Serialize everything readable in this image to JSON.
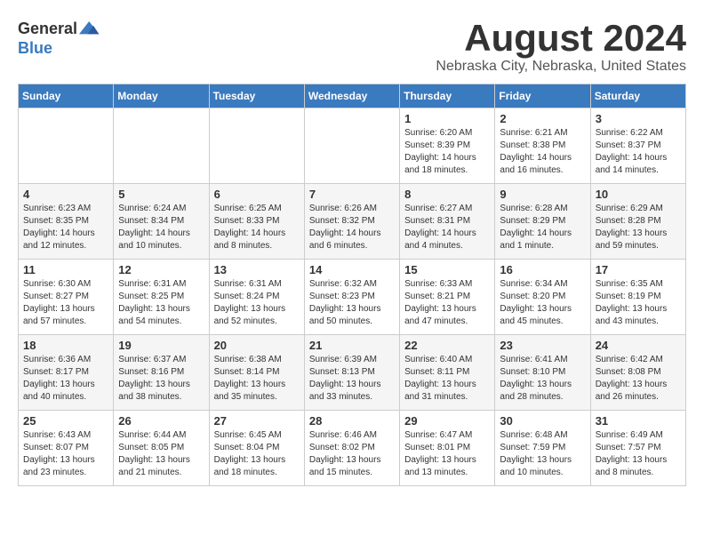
{
  "logo": {
    "general": "General",
    "blue": "Blue"
  },
  "title": "August 2024",
  "subtitle": "Nebraska City, Nebraska, United States",
  "days_of_week": [
    "Sunday",
    "Monday",
    "Tuesday",
    "Wednesday",
    "Thursday",
    "Friday",
    "Saturday"
  ],
  "weeks": [
    [
      {
        "day": "",
        "info": ""
      },
      {
        "day": "",
        "info": ""
      },
      {
        "day": "",
        "info": ""
      },
      {
        "day": "",
        "info": ""
      },
      {
        "day": "1",
        "info": "Sunrise: 6:20 AM\nSunset: 8:39 PM\nDaylight: 14 hours\nand 18 minutes."
      },
      {
        "day": "2",
        "info": "Sunrise: 6:21 AM\nSunset: 8:38 PM\nDaylight: 14 hours\nand 16 minutes."
      },
      {
        "day": "3",
        "info": "Sunrise: 6:22 AM\nSunset: 8:37 PM\nDaylight: 14 hours\nand 14 minutes."
      }
    ],
    [
      {
        "day": "4",
        "info": "Sunrise: 6:23 AM\nSunset: 8:35 PM\nDaylight: 14 hours\nand 12 minutes."
      },
      {
        "day": "5",
        "info": "Sunrise: 6:24 AM\nSunset: 8:34 PM\nDaylight: 14 hours\nand 10 minutes."
      },
      {
        "day": "6",
        "info": "Sunrise: 6:25 AM\nSunset: 8:33 PM\nDaylight: 14 hours\nand 8 minutes."
      },
      {
        "day": "7",
        "info": "Sunrise: 6:26 AM\nSunset: 8:32 PM\nDaylight: 14 hours\nand 6 minutes."
      },
      {
        "day": "8",
        "info": "Sunrise: 6:27 AM\nSunset: 8:31 PM\nDaylight: 14 hours\nand 4 minutes."
      },
      {
        "day": "9",
        "info": "Sunrise: 6:28 AM\nSunset: 8:29 PM\nDaylight: 14 hours\nand 1 minute."
      },
      {
        "day": "10",
        "info": "Sunrise: 6:29 AM\nSunset: 8:28 PM\nDaylight: 13 hours\nand 59 minutes."
      }
    ],
    [
      {
        "day": "11",
        "info": "Sunrise: 6:30 AM\nSunset: 8:27 PM\nDaylight: 13 hours\nand 57 minutes."
      },
      {
        "day": "12",
        "info": "Sunrise: 6:31 AM\nSunset: 8:25 PM\nDaylight: 13 hours\nand 54 minutes."
      },
      {
        "day": "13",
        "info": "Sunrise: 6:31 AM\nSunset: 8:24 PM\nDaylight: 13 hours\nand 52 minutes."
      },
      {
        "day": "14",
        "info": "Sunrise: 6:32 AM\nSunset: 8:23 PM\nDaylight: 13 hours\nand 50 minutes."
      },
      {
        "day": "15",
        "info": "Sunrise: 6:33 AM\nSunset: 8:21 PM\nDaylight: 13 hours\nand 47 minutes."
      },
      {
        "day": "16",
        "info": "Sunrise: 6:34 AM\nSunset: 8:20 PM\nDaylight: 13 hours\nand 45 minutes."
      },
      {
        "day": "17",
        "info": "Sunrise: 6:35 AM\nSunset: 8:19 PM\nDaylight: 13 hours\nand 43 minutes."
      }
    ],
    [
      {
        "day": "18",
        "info": "Sunrise: 6:36 AM\nSunset: 8:17 PM\nDaylight: 13 hours\nand 40 minutes."
      },
      {
        "day": "19",
        "info": "Sunrise: 6:37 AM\nSunset: 8:16 PM\nDaylight: 13 hours\nand 38 minutes."
      },
      {
        "day": "20",
        "info": "Sunrise: 6:38 AM\nSunset: 8:14 PM\nDaylight: 13 hours\nand 35 minutes."
      },
      {
        "day": "21",
        "info": "Sunrise: 6:39 AM\nSunset: 8:13 PM\nDaylight: 13 hours\nand 33 minutes."
      },
      {
        "day": "22",
        "info": "Sunrise: 6:40 AM\nSunset: 8:11 PM\nDaylight: 13 hours\nand 31 minutes."
      },
      {
        "day": "23",
        "info": "Sunrise: 6:41 AM\nSunset: 8:10 PM\nDaylight: 13 hours\nand 28 minutes."
      },
      {
        "day": "24",
        "info": "Sunrise: 6:42 AM\nSunset: 8:08 PM\nDaylight: 13 hours\nand 26 minutes."
      }
    ],
    [
      {
        "day": "25",
        "info": "Sunrise: 6:43 AM\nSunset: 8:07 PM\nDaylight: 13 hours\nand 23 minutes."
      },
      {
        "day": "26",
        "info": "Sunrise: 6:44 AM\nSunset: 8:05 PM\nDaylight: 13 hours\nand 21 minutes."
      },
      {
        "day": "27",
        "info": "Sunrise: 6:45 AM\nSunset: 8:04 PM\nDaylight: 13 hours\nand 18 minutes."
      },
      {
        "day": "28",
        "info": "Sunrise: 6:46 AM\nSunset: 8:02 PM\nDaylight: 13 hours\nand 15 minutes."
      },
      {
        "day": "29",
        "info": "Sunrise: 6:47 AM\nSunset: 8:01 PM\nDaylight: 13 hours\nand 13 minutes."
      },
      {
        "day": "30",
        "info": "Sunrise: 6:48 AM\nSunset: 7:59 PM\nDaylight: 13 hours\nand 10 minutes."
      },
      {
        "day": "31",
        "info": "Sunrise: 6:49 AM\nSunset: 7:57 PM\nDaylight: 13 hours\nand 8 minutes."
      }
    ]
  ]
}
